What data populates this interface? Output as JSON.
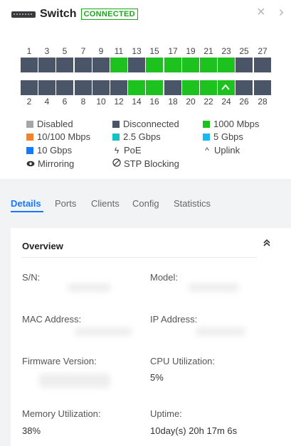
{
  "header": {
    "title": "Switch",
    "status": "CONNECTED",
    "close_icon": "×",
    "next_icon": "›"
  },
  "ports": {
    "top_numbers": [
      "1",
      "3",
      "5",
      "7",
      "9",
      "11",
      "13",
      "15",
      "17",
      "19",
      "21",
      "23",
      "25",
      "27"
    ],
    "bottom_numbers": [
      "2",
      "4",
      "6",
      "8",
      "10",
      "12",
      "14",
      "16",
      "18",
      "20",
      "22",
      "24",
      "26",
      "28"
    ],
    "top_states": [
      "disconnected",
      "disconnected",
      "disconnected",
      "disconnected",
      "disconnected",
      "1000",
      "disconnected",
      "1000",
      "1000",
      "1000",
      "1000",
      "1000",
      "disconnected",
      "disconnected"
    ],
    "bottom_states": [
      "disconnected",
      "disconnected",
      "disconnected",
      "disconnected",
      "disconnected",
      "disconnected",
      "1000",
      "1000",
      "disconnected",
      "1000",
      "1000",
      "1000-uplink",
      "disconnected",
      "disconnected"
    ]
  },
  "legend": {
    "disabled": "Disabled",
    "disconnected": "Disconnected",
    "mbps1000": "1000 Mbps",
    "mbps10_100": "10/100 Mbps",
    "gbps2_5": "2.5 Gbps",
    "gbps5": "5 Gbps",
    "gbps10": "10 Gbps",
    "poe": "PoE",
    "uplink": "Uplink",
    "mirroring": "Mirroring",
    "stp": "STP Blocking"
  },
  "colors": {
    "disabled": "#a6a6a6",
    "disconnected": "#4a5568",
    "mbps1000": "#1ec21e",
    "mbps10_100": "#f5822a",
    "gbps2_5": "#15c1c1",
    "gbps5": "#1ab8f0",
    "gbps10": "#1677ff"
  },
  "tabs": {
    "details": "Details",
    "ports": "Ports",
    "clients": "Clients",
    "config": "Config",
    "statistics": "Statistics"
  },
  "overview": {
    "title": "Overview",
    "sn_label": "S/N:",
    "model_label": "Model:",
    "mac_label": "MAC Address:",
    "ip_label": "IP Address:",
    "firmware_label": "Firmware Version:",
    "cpu_label": "CPU Utilization:",
    "cpu_value": "5%",
    "memory_label": "Memory Utilization:",
    "memory_value": "38%",
    "uptime_label": "Uptime:",
    "uptime_value": "10day(s) 20h 17m 6s"
  }
}
